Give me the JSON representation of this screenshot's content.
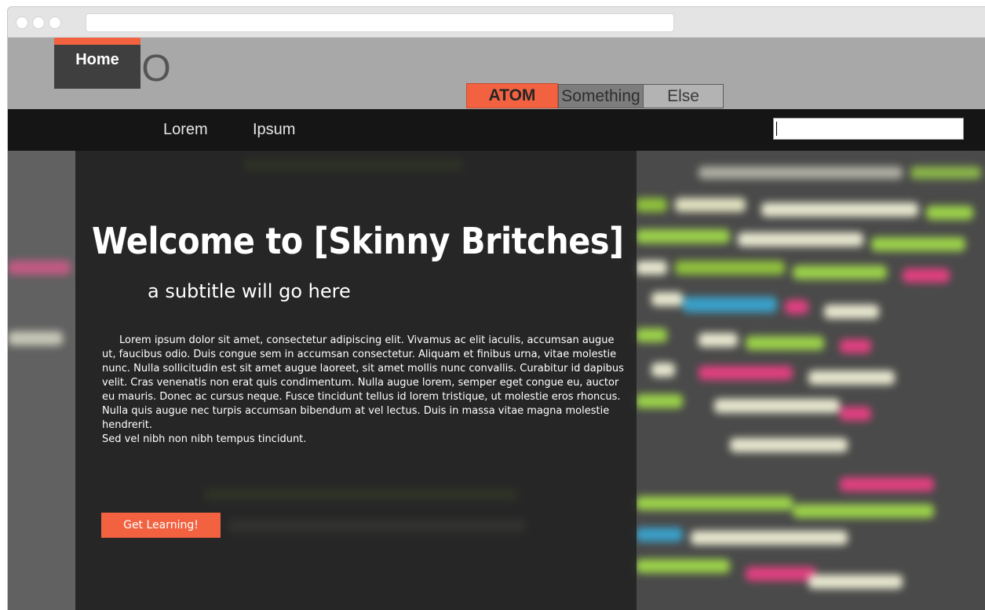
{
  "header": {
    "logo": "LOGO",
    "tabs": [
      "ATOM",
      "Something",
      "Else"
    ]
  },
  "nav": {
    "items": [
      "Home",
      "Lorem",
      "Ipsum"
    ],
    "search": {
      "value": "",
      "placeholder": ""
    }
  },
  "hero": {
    "title": "Welcome to [Skinny Britches]",
    "subtitle": "a subtitle will go here",
    "body": "Lorem ipsum dolor sit amet, consectetur adipiscing elit. Vivamus ac elit iaculis, accumsan augue ut, faucibus odio. Duis congue sem in accumsan consectetur. Aliquam et finibus urna, vitae molestie nunc. Nulla sollicitudin est sit amet augue laoreet, sit amet mollis nunc convallis. Curabitur id dapibus velit. Cras venenatis non erat quis condimentum. Nulla augue lorem, semper eget congue eu, auctor eu mauris. Donec ac cursus neque. Fusce tincidunt tellus id lorem tristique, ut molestie eros rhoncus. Nulla quis augue nec turpis accumsan bibendum at vel lectus. Duis in massa vitae magna molestie hendrerit.",
    "body_last": "Sed vel nibh non nibh tempus tincidunt.",
    "cta": "Get Learning!"
  },
  "colors": {
    "accent": "#f26241",
    "navbar": "#151515",
    "header": "#a8a8a8"
  }
}
